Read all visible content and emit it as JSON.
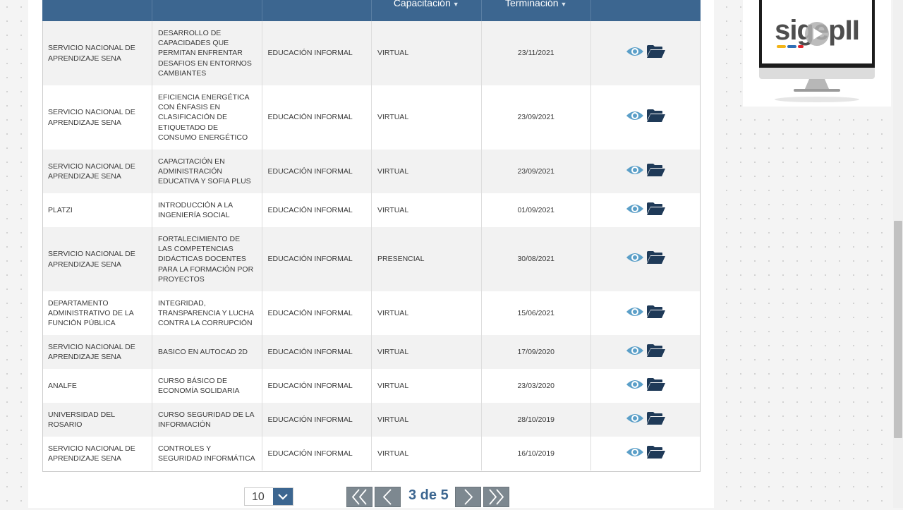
{
  "table": {
    "headers": [
      {
        "label": "",
        "sortable": false
      },
      {
        "label": "",
        "sortable": false
      },
      {
        "label": "",
        "sortable": false
      },
      {
        "label": "Capacitación",
        "sortable": true
      },
      {
        "label": "Terminación",
        "sortable": true
      },
      {
        "label": "",
        "sortable": false
      }
    ],
    "rows": [
      {
        "entidad": "SERVICIO NACIONAL DE APRENDIZAJE SENA",
        "nombre": "DESARROLLO DE CAPACIDADES QUE PERMITAN ENFRENTAR DESAFIOS EN ENTORNOS CAMBIANTES",
        "tipo": "EDUCACIÓN INFORMAL",
        "modalidad": "VIRTUAL",
        "fecha": "23/11/2021"
      },
      {
        "entidad": "SERVICIO NACIONAL DE APRENDIZAJE SENA",
        "nombre": "EFICIENCIA ENERGÉTICA CON ÉNFASIS EN CLASIFICACIÓN DE ETIQUETADO DE CONSUMO ENERGÉTICO",
        "tipo": "EDUCACIÓN INFORMAL",
        "modalidad": "VIRTUAL",
        "fecha": "23/09/2021"
      },
      {
        "entidad": "SERVICIO NACIONAL DE APRENDIZAJE SENA",
        "nombre": "CAPACITACIÓN EN ADMINISTRACIÓN EDUCATIVA Y SOFIA PLUS",
        "tipo": "EDUCACIÓN INFORMAL",
        "modalidad": "VIRTUAL",
        "fecha": "23/09/2021"
      },
      {
        "entidad": "PLATZI",
        "nombre": "INTRODUCCIÓN A LA INGENIERÍA SOCIAL",
        "tipo": "EDUCACIÓN INFORMAL",
        "modalidad": "VIRTUAL",
        "fecha": "01/09/2021"
      },
      {
        "entidad": "SERVICIO NACIONAL DE APRENDIZAJE SENA",
        "nombre": "FORTALECIMIENTO DE LAS COMPETENCIAS DIDÁCTICAS DOCENTES PARA LA FORMACIÓN POR PROYECTOS",
        "tipo": "EDUCACIÓN INFORMAL",
        "modalidad": "PRESENCIAL",
        "fecha": "30/08/2021"
      },
      {
        "entidad": "DEPARTAMENTO ADMINISTRATIVO DE LA FUNCIÓN PÚBLICA",
        "nombre": "INTEGRIDAD, TRANSPARENCIA Y LUCHA CONTRA LA CORRUPCIÓN",
        "tipo": "EDUCACIÓN INFORMAL",
        "modalidad": "VIRTUAL",
        "fecha": "15/06/2021"
      },
      {
        "entidad": "SERVICIO NACIONAL DE APRENDIZAJE SENA",
        "nombre": "BASICO EN AUTOCAD 2D",
        "tipo": "EDUCACIÓN INFORMAL",
        "modalidad": "VIRTUAL",
        "fecha": "17/09/2020"
      },
      {
        "entidad": "ANALFE",
        "nombre": "CURSO BÁSICO DE ECONOMÍA SOLIDARIA",
        "tipo": "EDUCACIÓN INFORMAL",
        "modalidad": "VIRTUAL",
        "fecha": "23/03/2020"
      },
      {
        "entidad": "UNIVERSIDAD DEL ROSARIO",
        "nombre": "CURSO SEGURIDAD DE LA INFORMACIÓN",
        "tipo": "EDUCACIÓN INFORMAL",
        "modalidad": "VIRTUAL",
        "fecha": "28/10/2019"
      },
      {
        "entidad": "SERVICIO NACIONAL DE APRENDIZAJE SENA",
        "nombre": "CONTROLES Y SEGURIDAD INFORMÁTICA",
        "tipo": "EDUCACIÓN INFORMAL",
        "modalidad": "VIRTUAL",
        "fecha": "16/10/2019"
      }
    ]
  },
  "pagination": {
    "per_page": "10",
    "status": "3 de 5"
  },
  "sidebar": {
    "video_logo_text": "sigepII",
    "logo_colors": [
      "#f2b418",
      "#2f6fb6",
      "#e0232b",
      "#4e4e4e"
    ]
  },
  "icons": {
    "view": "eye-icon",
    "documents": "folder-open-icon",
    "sort": "caret-down-icon",
    "first": "double-chevron-left-icon",
    "prev": "chevron-left-icon",
    "next": "chevron-right-icon",
    "last": "double-chevron-right-icon",
    "play": "play-icon"
  },
  "colors": {
    "header_bg": "#3c6690",
    "eye_icon": "#5b9fc8",
    "folder_icon": "#1f3a58",
    "nav_button": "#7d8890"
  }
}
